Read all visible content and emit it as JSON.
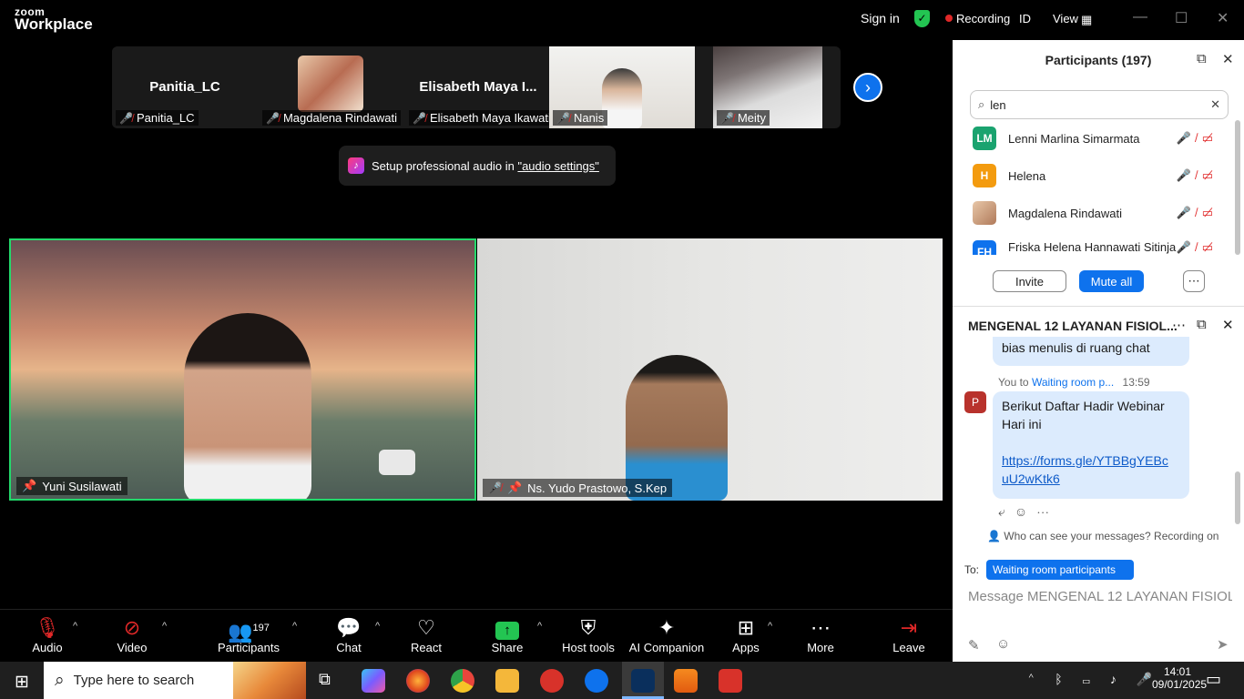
{
  "top": {
    "logo_small": "zoom",
    "logo": "Workplace",
    "sign_in": "Sign in",
    "recording": "Recording",
    "id": "ID",
    "view": "View"
  },
  "strip": [
    {
      "name": "Panitia_LC",
      "label": "Panitia_LC"
    },
    {
      "name": "",
      "label": "Magdalena Rindawati"
    },
    {
      "name": "Elisabeth Maya I...",
      "label": "Elisabeth Maya Ikawati"
    },
    {
      "name": "",
      "label": "Nanis"
    },
    {
      "name": "",
      "label": "Meity"
    }
  ],
  "toast": {
    "text": "Setup professional audio in ",
    "link": "\"audio settings\""
  },
  "videos": [
    {
      "label": "Yuni Susilawati"
    },
    {
      "label": "Ns. Yudo Prastowo, S.Kep"
    }
  ],
  "toolbar": {
    "audio": "Audio",
    "video": "Video",
    "participants": "Participants",
    "participants_count": "197",
    "chat": "Chat",
    "react": "React",
    "share": "Share",
    "host_tools": "Host tools",
    "ai": "AI Companion",
    "apps": "Apps",
    "more": "More",
    "leave": "Leave"
  },
  "participants": {
    "title": "Participants (197)",
    "search_value": "len",
    "items": [
      {
        "initials": "LM",
        "name": "Lenni Marlina Simarmata",
        "color": "#1aa36f"
      },
      {
        "initials": "H",
        "name": "Helena",
        "color": "#f39b0f"
      },
      {
        "initials": "",
        "name": "Magdalena Rindawati",
        "color": "#b07a5a"
      },
      {
        "initials": "FH",
        "name": "Friska Helena Hannawati Sitinja...",
        "color": "#0e72ed"
      }
    ],
    "invite": "Invite",
    "mute_all": "Mute all"
  },
  "chat": {
    "title": "MENGENAL 12 LAYANAN FISIOL...",
    "prev_msg": "bias menulis di ruang chat",
    "sender": "You to",
    "recipient": "Waiting room p...",
    "time": "13:59",
    "avatar": "P",
    "msg_line1": "Berikut Daftar Hadir Webinar",
    "msg_line2": "Hari ini",
    "link_line1": "https://forms.gle/YTBBgYEBc",
    "link_line2": "uU2wKtk6",
    "notice": "Who can see your messages? Recording on",
    "to_label": "To:",
    "to_value": "Waiting room participants",
    "placeholder": "Message MENGENAL 12 LAYANAN FISIOL..."
  },
  "taskbar": {
    "search": "Type here to search",
    "time": "14:01",
    "date": "09/01/2025"
  }
}
